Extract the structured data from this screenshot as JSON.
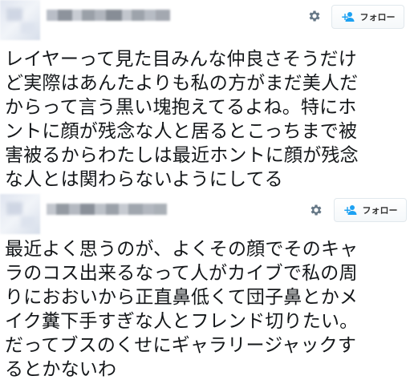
{
  "tweets": [
    {
      "follow_label": "フォロー",
      "avatar_icon": "blurred-avatar",
      "settings_icon": "gear-icon",
      "follow_icon": "add-user-icon",
      "lines": [
        "レイヤーって見た目みんな仲良さそうだけ",
        "ど実際はあんたよりも私の方がまだ美人だ",
        "からって言う黒い塊抱えてるよね。特にホ",
        "ントに顔が残念な人と居るとこっちまで被",
        "害被るからわたしは最近ホントに顔が残念",
        "な人とは関わらないようにしてる"
      ]
    },
    {
      "follow_label": "フォロー",
      "avatar_icon": "blurred-avatar",
      "settings_icon": "gear-icon",
      "follow_icon": "add-user-icon",
      "lines": [
        "最近よく思うのが、よくその顔でそのキャ",
        "ラのコス出来るなって人がカイブで私の周",
        "りにおおいから正直鼻低くて団子鼻とかメ",
        "イク糞下手すぎな人とフレンド切りたい。",
        "だってブスのくせにギャラリージャックす",
        "るとかないわ"
      ]
    }
  ],
  "colors": {
    "follow_accent": "#1da1f2",
    "icon_gray": "#657786",
    "text": "#14171a"
  }
}
